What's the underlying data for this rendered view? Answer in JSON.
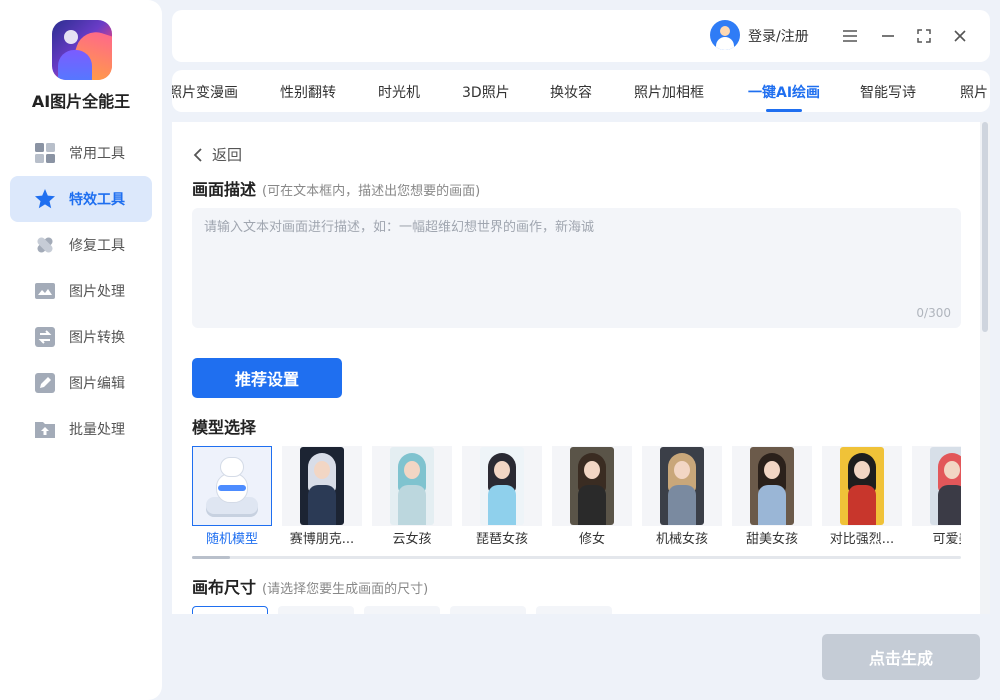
{
  "app": {
    "name": "AI图片全能王"
  },
  "sidebar": {
    "items": [
      {
        "label": "常用工具",
        "icon": "grid-icon",
        "active": false
      },
      {
        "label": "特效工具",
        "icon": "star-icon",
        "active": true
      },
      {
        "label": "修复工具",
        "icon": "bandage-icon",
        "active": false
      },
      {
        "label": "图片处理",
        "icon": "image-icon",
        "active": false
      },
      {
        "label": "图片转换",
        "icon": "convert-icon",
        "active": false
      },
      {
        "label": "图片编辑",
        "icon": "edit-icon",
        "active": false
      },
      {
        "label": "批量处理",
        "icon": "upload-icon",
        "active": false
      }
    ]
  },
  "topbar": {
    "login_label": "登录/注册"
  },
  "tabs": [
    {
      "label": "照片变漫画"
    },
    {
      "label": "性别翻转"
    },
    {
      "label": "时光机"
    },
    {
      "label": "3D照片"
    },
    {
      "label": "换妆容"
    },
    {
      "label": "照片加相框"
    },
    {
      "label": "一键AI绘画",
      "active": true
    },
    {
      "label": "智能写诗"
    },
    {
      "label": "照片"
    }
  ],
  "content": {
    "back_label": "返回",
    "description": {
      "title": "画面描述",
      "hint": "(可在文本框内，描述出您想要的画面)",
      "placeholder": "请输入文本对画面进行描述，如：一幅超维幻想世界的画作，新海诚",
      "counter": "0/300"
    },
    "recommend_button": "推荐设置",
    "model_section": {
      "title": "模型选择",
      "models": [
        {
          "label": "随机模型",
          "selected": true
        },
        {
          "label": "赛博朋克..."
        },
        {
          "label": "云女孩"
        },
        {
          "label": "琵琶女孩"
        },
        {
          "label": "修女"
        },
        {
          "label": "机械女孩"
        },
        {
          "label": "甜美女孩"
        },
        {
          "label": "对比强烈..."
        },
        {
          "label": "可爱美"
        }
      ]
    },
    "canvas_section": {
      "title": "画布尺寸",
      "hint": "(请选择您要生成画面的尺寸)"
    }
  },
  "generate_button": "点击生成"
}
